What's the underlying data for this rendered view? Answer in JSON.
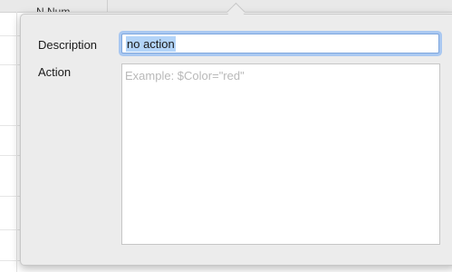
{
  "background_table": {
    "header_text": "N Num"
  },
  "popover": {
    "description_label": "Description",
    "description_value": "no action",
    "action_label": "Action",
    "action_placeholder": "Example: $Color=\"red\"",
    "action_value": ""
  },
  "colors": {
    "popover_bg": "#ececec",
    "focus_ring": "#a9c8f1",
    "selection": "#b3d4f8",
    "placeholder": "#b9b9b9"
  }
}
